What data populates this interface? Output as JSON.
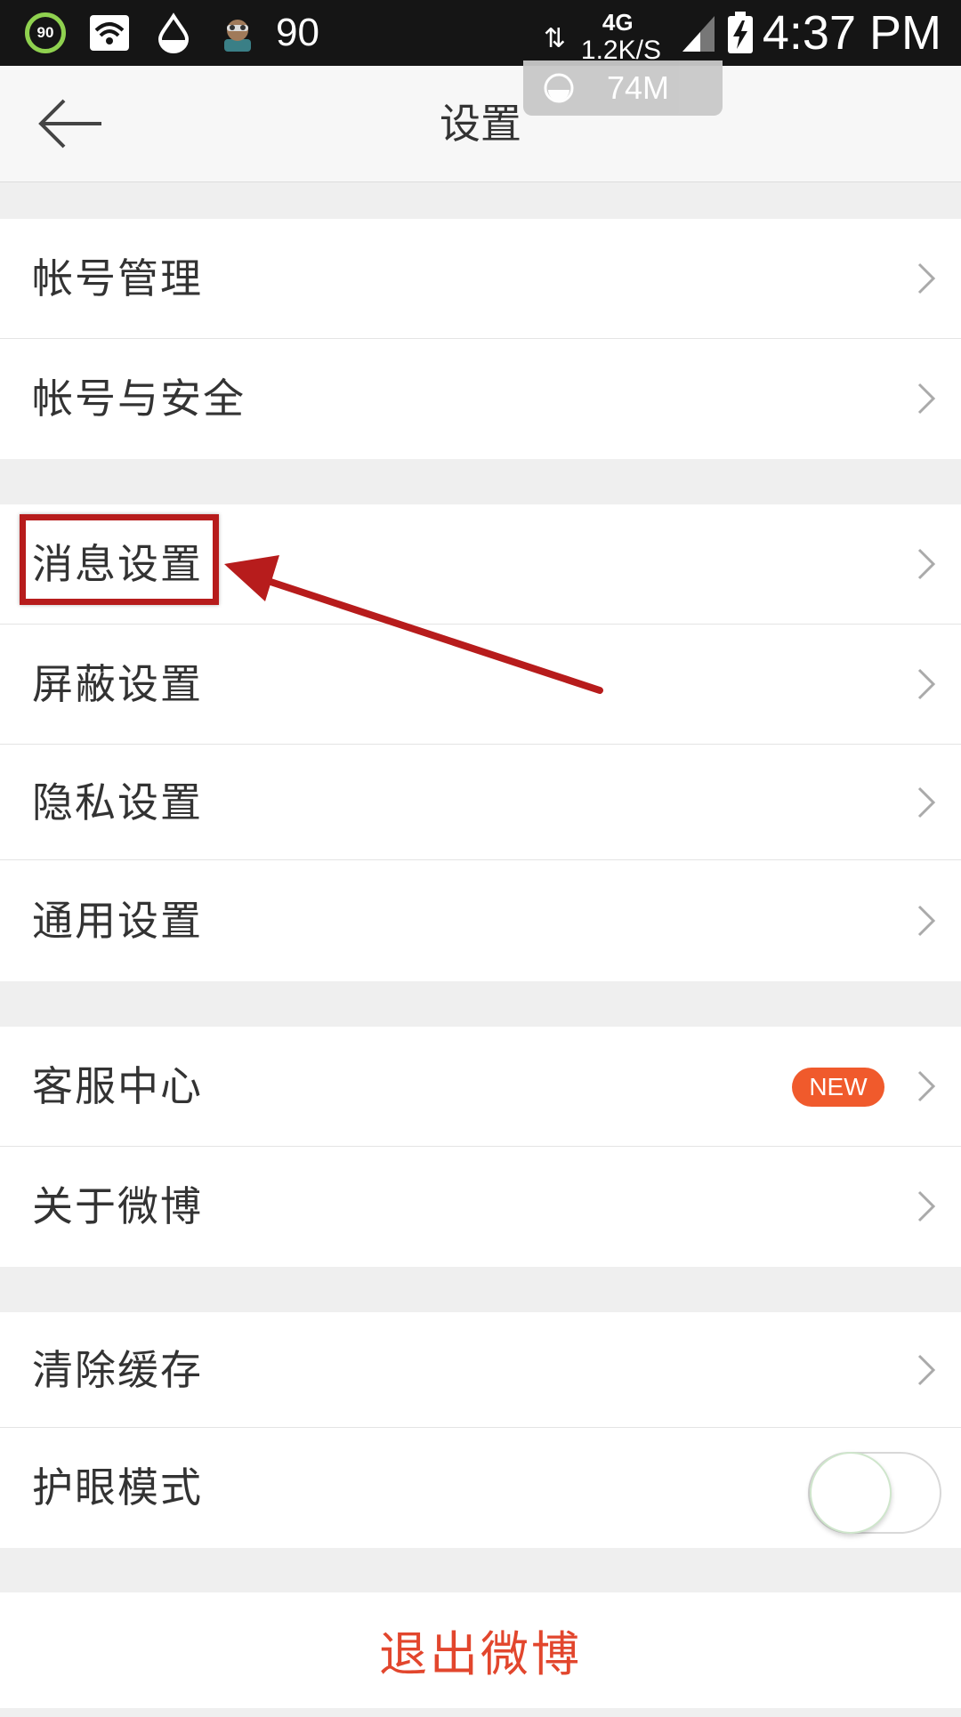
{
  "status_bar": {
    "battery_ring": "90",
    "num": "90",
    "net_arrows": "⇅",
    "network_type": "4G",
    "speed": "1.2K/S",
    "time": "4:37 PM",
    "memory": "74M"
  },
  "header": {
    "title": "设置"
  },
  "groups": [
    {
      "items": [
        {
          "label": "帐号管理"
        },
        {
          "label": "帐号与安全"
        }
      ]
    },
    {
      "items": [
        {
          "label": "消息设置"
        },
        {
          "label": "屏蔽设置"
        },
        {
          "label": "隐私设置"
        },
        {
          "label": "通用设置"
        }
      ]
    },
    {
      "items": [
        {
          "label": "客服中心",
          "badge": "NEW"
        },
        {
          "label": "关于微博"
        }
      ]
    },
    {
      "items": [
        {
          "label": "清除缓存"
        },
        {
          "label": "护眼模式",
          "toggle_on": false
        }
      ]
    }
  ],
  "logout_label": "退出微博",
  "colors": {
    "accent_red": "#e2462d",
    "badge_orange": "#f05a2c",
    "annotation_red": "#b71c1c"
  }
}
